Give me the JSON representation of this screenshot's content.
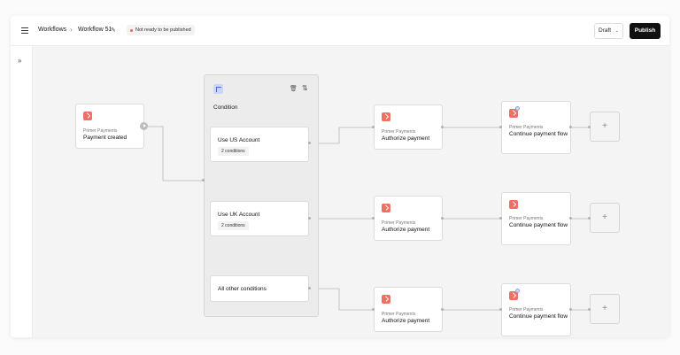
{
  "header": {
    "breadcrumb_root": "Workflows",
    "breadcrumb_separator": "›",
    "breadcrumb_current": "Workflow 51",
    "status_badge": "Not ready to be published",
    "draft_label": "Draft",
    "publish_label": "Publish"
  },
  "trigger": {
    "provider": "Primer Payments",
    "action": "Payment created"
  },
  "condition": {
    "title": "Condition",
    "branches": [
      {
        "label": "Use US Account",
        "count": "2 conditions"
      },
      {
        "label": "Use UK Account",
        "count": "2 conditions"
      },
      {
        "label": "All other conditions"
      }
    ]
  },
  "rows": [
    {
      "authorize": {
        "provider": "Primer Payments",
        "action": "Authorize payment"
      },
      "continue": {
        "provider": "Primer Payments",
        "action": "Continue payment flow"
      }
    },
    {
      "authorize": {
        "provider": "Primer Payments",
        "action": "Authorize payment"
      },
      "continue": {
        "provider": "Primer Payments",
        "action": "Continue payment flow"
      }
    },
    {
      "authorize": {
        "provider": "Primer Payments",
        "action": "Authorize payment"
      },
      "continue": {
        "provider": "Primer Payments",
        "action": "Continue payment flow"
      }
    }
  ],
  "add_symbol": "+",
  "icons": [
    "menu-icon",
    "pencil-icon",
    "chevron-down-icon",
    "expand-sidebar-icon",
    "play-icon",
    "condition-icon",
    "trash-icon",
    "sort-icon",
    "primer-logo-icon",
    "plus-icon"
  ],
  "colors": {
    "publish": "#111111",
    "badge_dot": "#e8675a",
    "logo": "#ef6f62",
    "condition_icon": "#cbd6ff"
  }
}
